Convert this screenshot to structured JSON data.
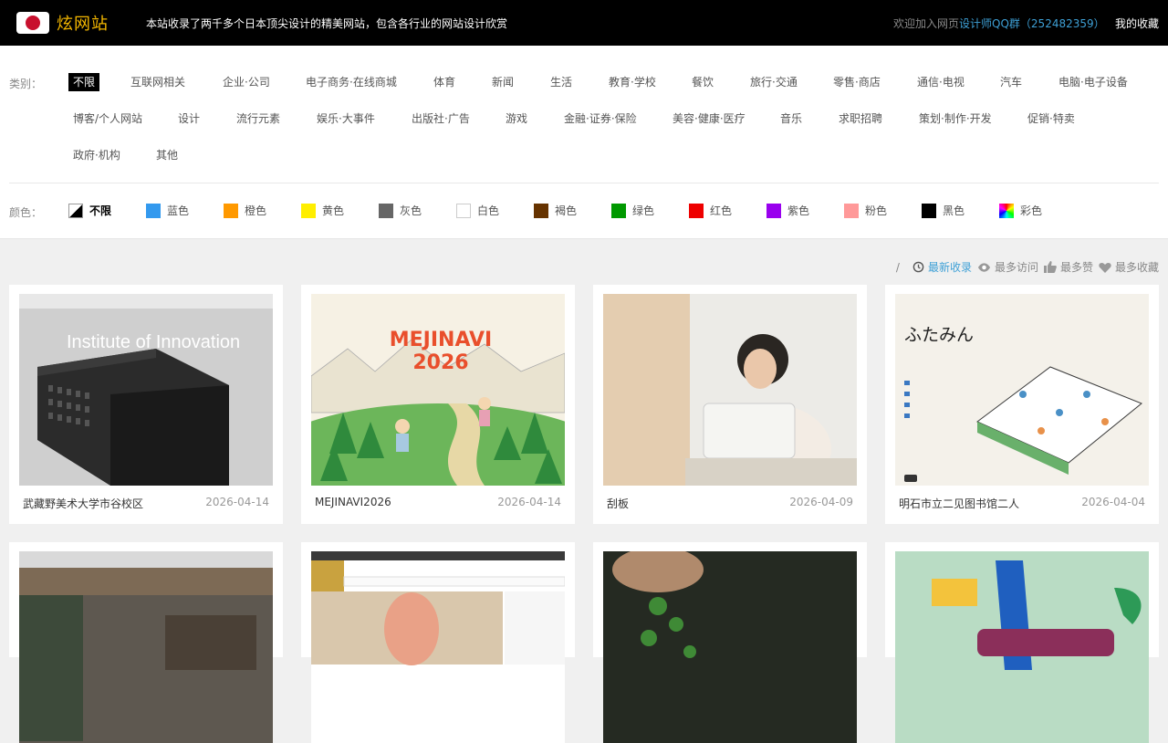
{
  "header": {
    "logo_text": "炫网站",
    "tagline": "本站收录了两千多个日本顶尖设计的精美网站，包含各行业的网站设计欣赏",
    "join_prefix": "欢迎加入网页",
    "join_link": "设计师QQ群",
    "join_number": "（252482359）",
    "favorites": "我的收藏"
  },
  "category": {
    "label": "类别：",
    "items": [
      "不限",
      "互联网相关",
      "企业·公司",
      "电子商务·在线商城",
      "体育",
      "新闻",
      "生活",
      "教育·学校",
      "餐饮",
      "旅行·交通",
      "零售·商店",
      "通信·电视",
      "汽车",
      "电脑·电子设备",
      "博客/个人网站",
      "设计",
      "流行元素",
      "娱乐·大事件",
      "出版社·广告",
      "游戏",
      "金融·证券·保险",
      "美容·健康·医疗",
      "音乐",
      "求职招聘",
      "策划·制作·开发",
      "促销·特卖",
      "政府·机构",
      "其他"
    ]
  },
  "color": {
    "label": "颜色：",
    "items": [
      {
        "name": "不限",
        "hex": "#000000"
      },
      {
        "name": "蓝色",
        "hex": "#3399ee"
      },
      {
        "name": "橙色",
        "hex": "#ff9900"
      },
      {
        "name": "黄色",
        "hex": "#ffee00"
      },
      {
        "name": "灰色",
        "hex": "#666666"
      },
      {
        "name": "白色",
        "hex": "#ffffff"
      },
      {
        "name": "褐色",
        "hex": "#663300"
      },
      {
        "name": "绿色",
        "hex": "#009900"
      },
      {
        "name": "红色",
        "hex": "#ee0000"
      },
      {
        "name": "紫色",
        "hex": "#9900ee"
      },
      {
        "name": "粉色",
        "hex": "#ff9999"
      },
      {
        "name": "黑色",
        "hex": "#000000"
      },
      {
        "name": "彩色",
        "hex": "rainbow"
      }
    ]
  },
  "sort": {
    "separator": "/",
    "items": [
      "最新收录",
      "最多访问",
      "最多赞",
      "最多收藏"
    ]
  },
  "cards": [
    {
      "title": "武藏野美术大学市谷校区",
      "date": "2026-04-14",
      "thumb_text": "Institute of Innovation"
    },
    {
      "title": "MEJINAVI2026",
      "date": "2026-04-14",
      "thumb_text": "MEJINAVI 2026"
    },
    {
      "title": "刮板",
      "date": "2026-04-09",
      "thumb_text": ""
    },
    {
      "title": "明石市立二见图书馆二人",
      "date": "2026-04-04",
      "thumb_text": "ふたみん"
    },
    {
      "title": "",
      "date": "",
      "thumb_text": ""
    },
    {
      "title": "",
      "date": "",
      "thumb_text": ""
    },
    {
      "title": "",
      "date": "",
      "thumb_text": ""
    },
    {
      "title": "",
      "date": "",
      "thumb_text": ""
    }
  ]
}
